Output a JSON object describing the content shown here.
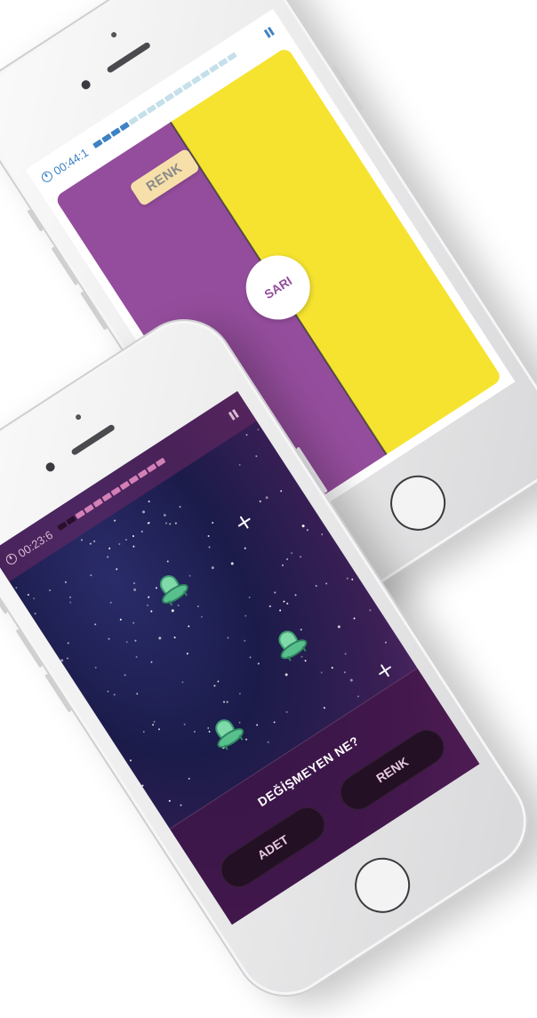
{
  "top_phone": {
    "timer": "00:44:1",
    "rule_label": "RENK",
    "center_word": "SARI",
    "progress_segments": 16,
    "progress_filled": 4,
    "colors": {
      "left": "#944d9c",
      "right": "#f5e32f",
      "progress_filled": "#3e82c4",
      "progress_empty": "#c5e0ea"
    }
  },
  "bottom_phone": {
    "timer": "00:23:6",
    "question": "DEĞİŞMEYEN NE?",
    "answers": [
      "ADET",
      "RENK"
    ],
    "progress_segments": 12,
    "progress_filled": 2,
    "colors": {
      "progress_filled": "#2a0f2a",
      "progress_empty": "#d47fb6"
    }
  }
}
